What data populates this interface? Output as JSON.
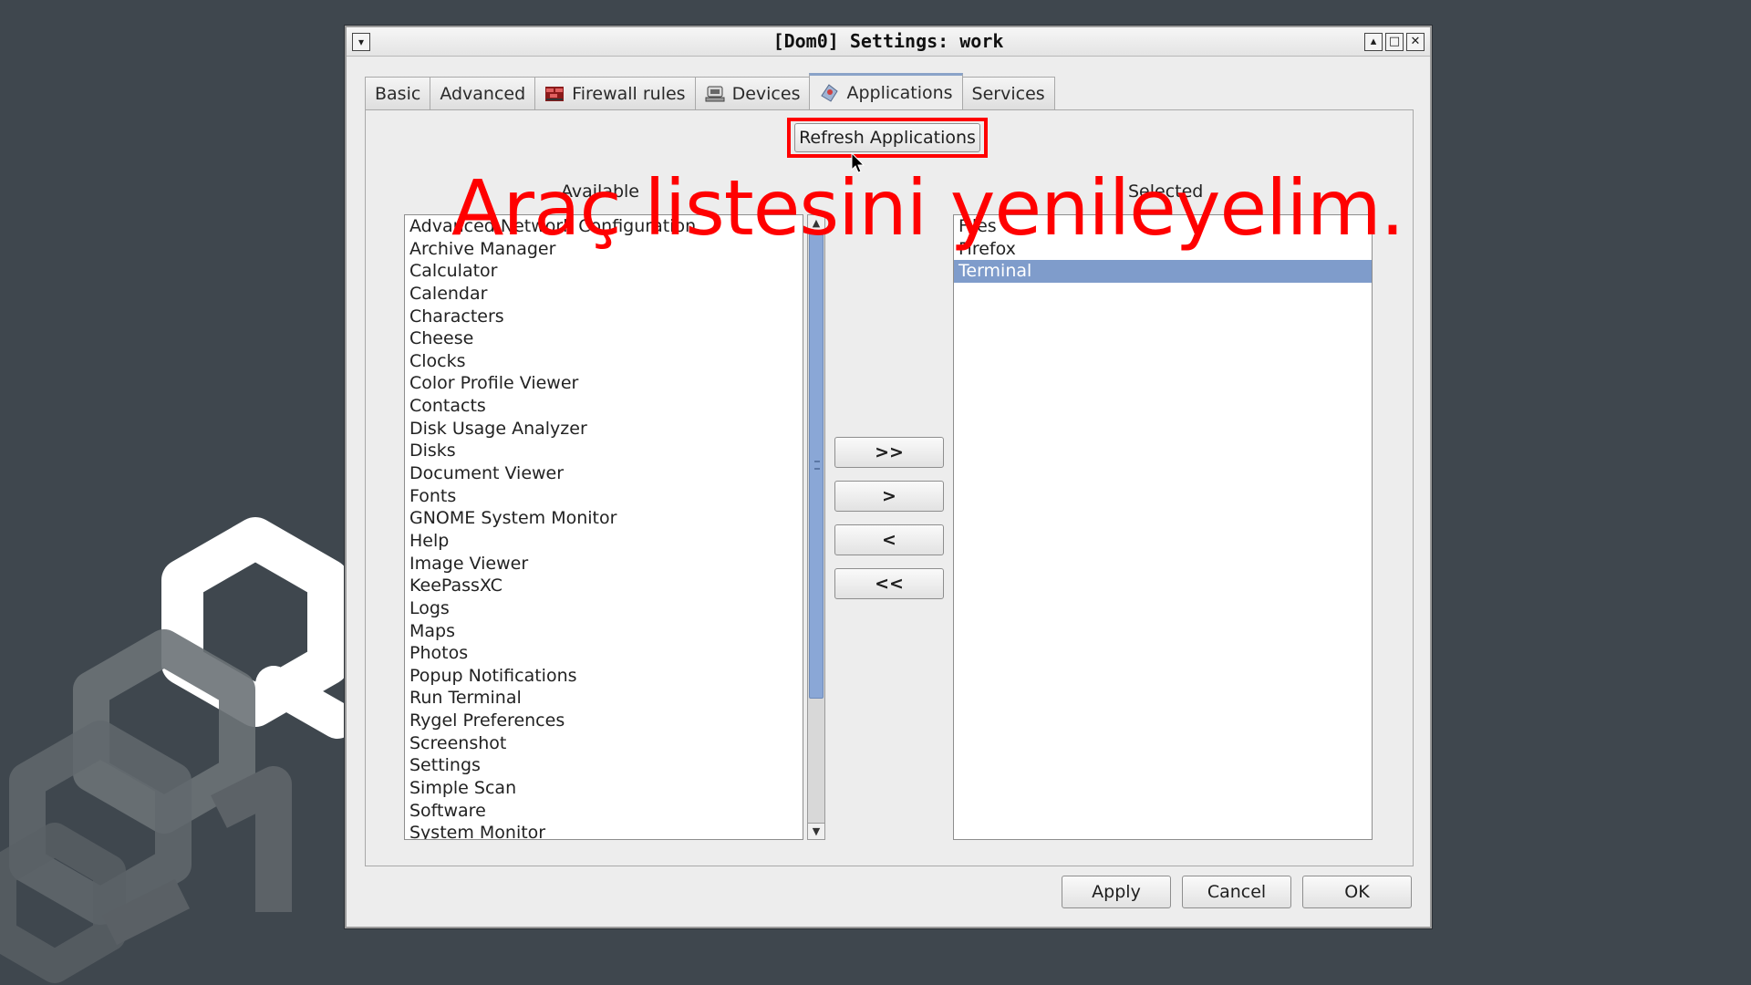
{
  "window": {
    "title": "[Dom0] Settings: work",
    "menu_icon": "window-menu-icon",
    "controls": [
      "shade-icon",
      "maximize-icon",
      "close-icon"
    ]
  },
  "tabs": [
    {
      "label": "Basic",
      "icon": null
    },
    {
      "label": "Advanced",
      "icon": null
    },
    {
      "label": "Firewall rules",
      "icon": "firewall-icon"
    },
    {
      "label": "Devices",
      "icon": "devices-icon"
    },
    {
      "label": "Applications",
      "icon": "applications-icon",
      "active": true
    },
    {
      "label": "Services",
      "icon": null
    }
  ],
  "applications": {
    "refresh_label": "Refresh Applications",
    "available_label": "Available",
    "selected_label": "Selected",
    "available": [
      "Advanced Network Configuration",
      "Archive Manager",
      "Calculator",
      "Calendar",
      "Characters",
      "Cheese",
      "Clocks",
      "Color Profile Viewer",
      "Contacts",
      "Disk Usage Analyzer",
      "Disks",
      "Document Viewer",
      "Fonts",
      "GNOME System Monitor",
      "Help",
      "Image Viewer",
      "KeePassXC",
      "Logs",
      "Maps",
      "Photos",
      "Popup Notifications",
      "Run Terminal",
      "Rygel Preferences",
      "Screenshot",
      "Settings",
      "Simple Scan",
      "Software",
      "System Monitor"
    ],
    "selected": [
      "Files",
      "Firefox",
      "Terminal"
    ],
    "selected_highlight": "Terminal",
    "move_buttons": {
      "all_right": ">>",
      "right": ">",
      "left": "<",
      "all_left": "<<"
    }
  },
  "footer": {
    "apply": "Apply",
    "cancel": "Cancel",
    "ok": "OK"
  },
  "overlay_caption": "Araç listesini yenileyelim.",
  "colors": {
    "desktop": "#3f474e",
    "selection": "#7f9ccb",
    "highlight": "#ff0000"
  }
}
